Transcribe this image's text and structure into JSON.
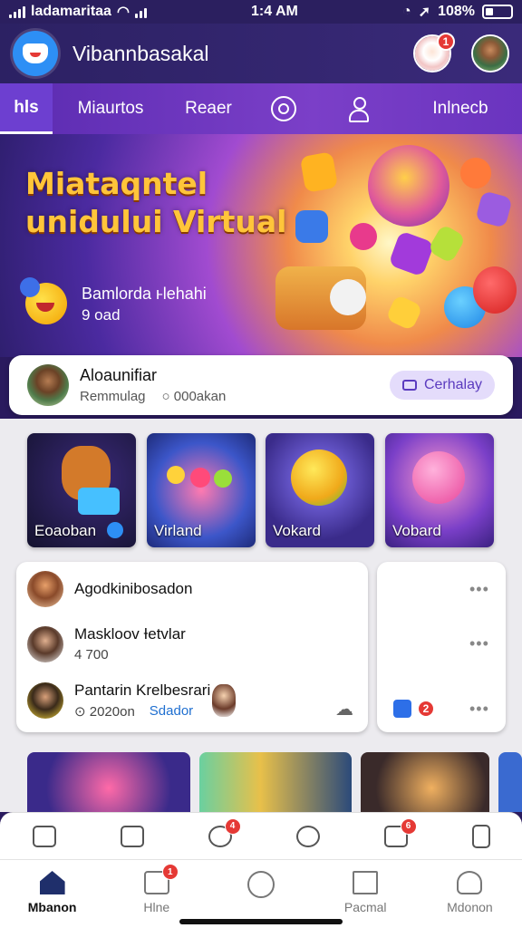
{
  "status_bar": {
    "carrier": "ladamaritaa",
    "time": "1:4 AM",
    "battery": "108%"
  },
  "header": {
    "app_title": "Vibannbasakal",
    "notif_count": "1"
  },
  "tabs": [
    {
      "label": "hls",
      "active": true
    },
    {
      "label": "Miaurtos"
    },
    {
      "label": "Reaer"
    },
    {
      "icon": "target-icon"
    },
    {
      "icon": "user-icon"
    },
    {
      "label": "Inlnecb"
    }
  ],
  "hero": {
    "title_line1": "Miataqntel",
    "title_line2": "unidului Virtual",
    "subtitle": "Bamlorda ⱶlehahi",
    "subtitle2": "9 oad"
  },
  "profile": {
    "name": "Aloaunifiar",
    "role": "Remmulag",
    "views": "○ 000akan",
    "button": "Cerhalay"
  },
  "tiles": [
    {
      "label": "Eoaoban",
      "colors": [
        "#1b1a3a",
        "#ff9a3a"
      ]
    },
    {
      "label": "Virland",
      "colors": [
        "#2b47b5",
        "#ff5ea6"
      ]
    },
    {
      "label": "Vokard",
      "colors": [
        "#3a2b8a",
        "#f6c13a"
      ]
    },
    {
      "label": "Vobard",
      "colors": [
        "#4b2aa0",
        "#ff6fb4"
      ]
    }
  ],
  "list": [
    {
      "name": "Agodkinibosadon",
      "sub": ""
    },
    {
      "name": "Maskloov Ɨetvlar",
      "sub": "4 700"
    },
    {
      "name": "Pantarin Krelbesrari",
      "sub": "⊙ 2020on",
      "sub2": "Sdador"
    }
  ],
  "side_badge": "2",
  "toolbar_badges": [
    "4",
    "6"
  ],
  "nav": [
    {
      "label": "Mbanon",
      "active": true
    },
    {
      "label": "Hlne",
      "badge": "1"
    },
    {
      "label": ""
    },
    {
      "label": "Pacmal"
    },
    {
      "label": "Mdonon"
    }
  ],
  "colors": {
    "accent": "#6d3fd0",
    "header": "#2c2163",
    "badge": "#e53935"
  }
}
